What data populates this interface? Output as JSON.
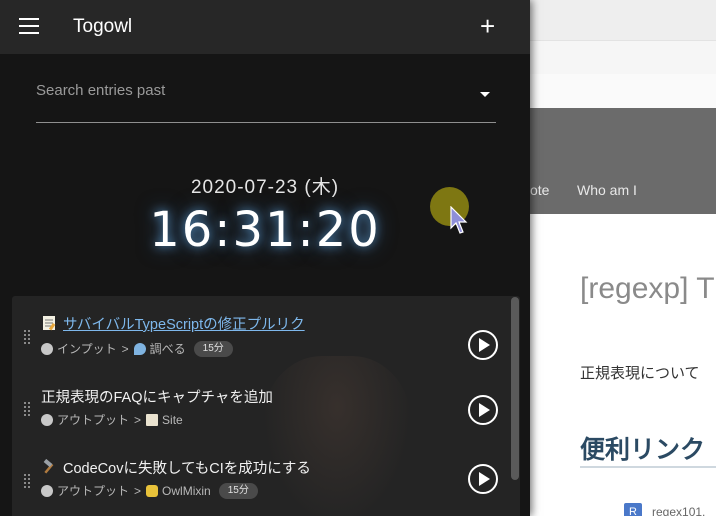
{
  "background_page": {
    "nav_items": [
      "ote",
      "Who am I"
    ],
    "title": "[regexp] T",
    "intro_text": "正規表現について",
    "section_heading": "便利リンク",
    "link_badge": "R",
    "link_text": "regex101."
  },
  "appbar": {
    "title": "Togowl",
    "menu_icon": "hamburger-menu-icon",
    "add_icon": "plus-icon",
    "add_label": "+"
  },
  "search": {
    "placeholder": "Search entries past",
    "value": ""
  },
  "clock": {
    "date": "2020-07-23 (木)",
    "time": "16:31:20"
  },
  "entries": [
    {
      "title": "サバイバルTypeScriptの修正プルリク",
      "title_icon": "memo-icon",
      "is_link": true,
      "project": "インプット",
      "project_icon": "skull-icon",
      "separator": ">",
      "client": "調べる",
      "client_icon": "magnifier-icon",
      "duration": "15分"
    },
    {
      "title": "正規表現のFAQにキャプチャを追加",
      "title_icon": "",
      "is_link": false,
      "project": "アウトプット",
      "project_icon": "skull-icon",
      "separator": ">",
      "client": "Site",
      "client_icon": "scroll-icon",
      "duration": ""
    },
    {
      "title": "CodeCovに失敗してもCIを成功にする",
      "title_icon": "hammer-icon",
      "is_link": false,
      "project": "アウトプット",
      "project_icon": "skull-icon",
      "separator": ">",
      "client": "OwlMixin",
      "client_icon": "owl-icon",
      "duration": "15分"
    }
  ],
  "colors": {
    "panel_bg": "#151515",
    "appbar_bg": "#272727",
    "list_bg": "#242424",
    "link": "#7eb8ec",
    "cursor_highlight": "#8a8212"
  }
}
